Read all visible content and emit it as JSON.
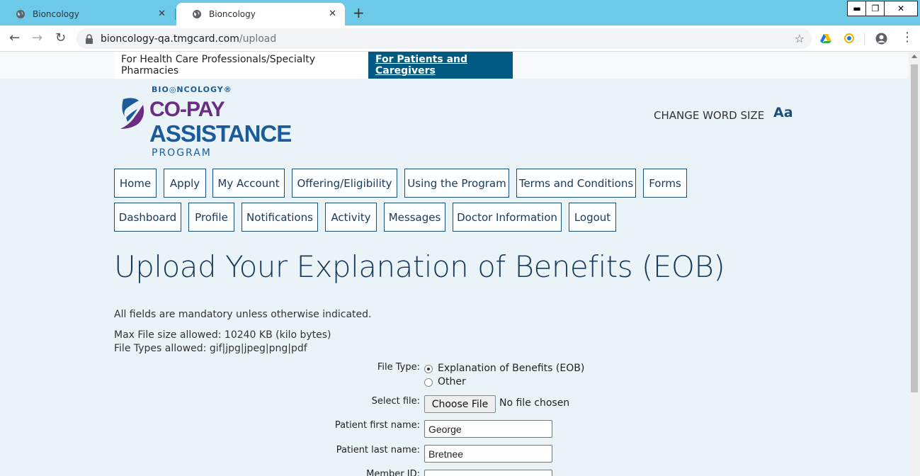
{
  "browser": {
    "tabs": [
      {
        "title": "Bioncology"
      },
      {
        "title": "Bioncology"
      }
    ],
    "new_tab_label": "+",
    "window_controls": {
      "minimize": "▬",
      "maximize": "❐",
      "close": "✕"
    },
    "url_host": "bioncology-qa.tmgcard.com",
    "url_path": "/upload",
    "icons": [
      "back-icon",
      "forward-icon",
      "reload-icon",
      "lock-icon",
      "star-icon",
      "drive-extension-icon",
      "sync-extension-icon",
      "profile-icon",
      "menu-icon"
    ]
  },
  "audience": {
    "hcp": "For Health Care Professionals/Specialty Pharmacies",
    "patients": "For Patients and Caregivers"
  },
  "logo": {
    "brand": "BIO◎NCOLOGY®",
    "line1": "CO-PAY",
    "line2": "ASSISTANCE",
    "line3": "PROGRAM"
  },
  "word_size": {
    "label": "CHANGE WORD SIZE",
    "icon": "Aa"
  },
  "nav_row1": [
    "Home",
    "Apply",
    "My Account",
    "Offering/Eligibility",
    "Using the Program",
    "Terms and Conditions",
    "Forms"
  ],
  "nav_row2": [
    "Dashboard",
    "Profile",
    "Notifications",
    "Activity",
    "Messages",
    "Doctor Information",
    "Logout"
  ],
  "page": {
    "title": "Upload Your Explanation of Benefits (EOB)",
    "mandatory_note": "All fields are mandatory unless otherwise indicated.",
    "max_size": "Max File size allowed: 10240 KB (kilo bytes)",
    "file_types": "File Types allowed: gif|jpg|jpeg|png|pdf"
  },
  "form": {
    "file_type_label": "File Type:",
    "file_type_options": [
      "Explanation of Benefits (EOB)",
      "Other"
    ],
    "file_type_selected": "Explanation of Benefits (EOB)",
    "select_file_label": "Select file:",
    "choose_file_button": "Choose File",
    "no_file_text": "No file chosen",
    "first_name_label": "Patient first name:",
    "first_name_value": "George",
    "last_name_label": "Patient last name:",
    "last_name_value": "Bretnee",
    "member_id_label": "Member ID:"
  },
  "colors": {
    "tabbar": "#6dc9e8",
    "page_bg": "#eaf4f8",
    "active_audience": "#005a82",
    "nav_text": "#1b3a5a"
  }
}
